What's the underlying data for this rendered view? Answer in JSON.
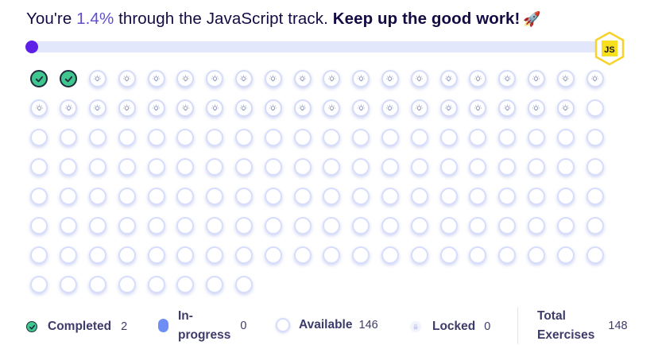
{
  "header": {
    "prefix": "You're ",
    "percent": "1.4%",
    "middle": " through the JavaScript track. ",
    "encouragement": "Keep up the good work!",
    "emoji": "🚀",
    "track_badge": "JS",
    "progress_fraction": 0.014
  },
  "colors": {
    "completed": "#40c68f",
    "in_progress": "#6d8ef5",
    "progress_dot": "#5e1fe6",
    "bar_track": "#e3e7fb",
    "js_badge": "#f7df1e"
  },
  "exercises": {
    "completed_count": 2,
    "available_with_icon": 37,
    "plain_available": 109
  },
  "legend": {
    "completed": {
      "label": "Completed",
      "count": "2"
    },
    "in_progress": {
      "label_line1": "In-",
      "label_line2": "progress",
      "count": "0"
    },
    "available": {
      "label": "Available",
      "count": "146"
    },
    "locked": {
      "label": "Locked",
      "count": "0"
    },
    "total": {
      "label_line1": "Total",
      "label_line2": "Exercises",
      "count": "148"
    }
  }
}
